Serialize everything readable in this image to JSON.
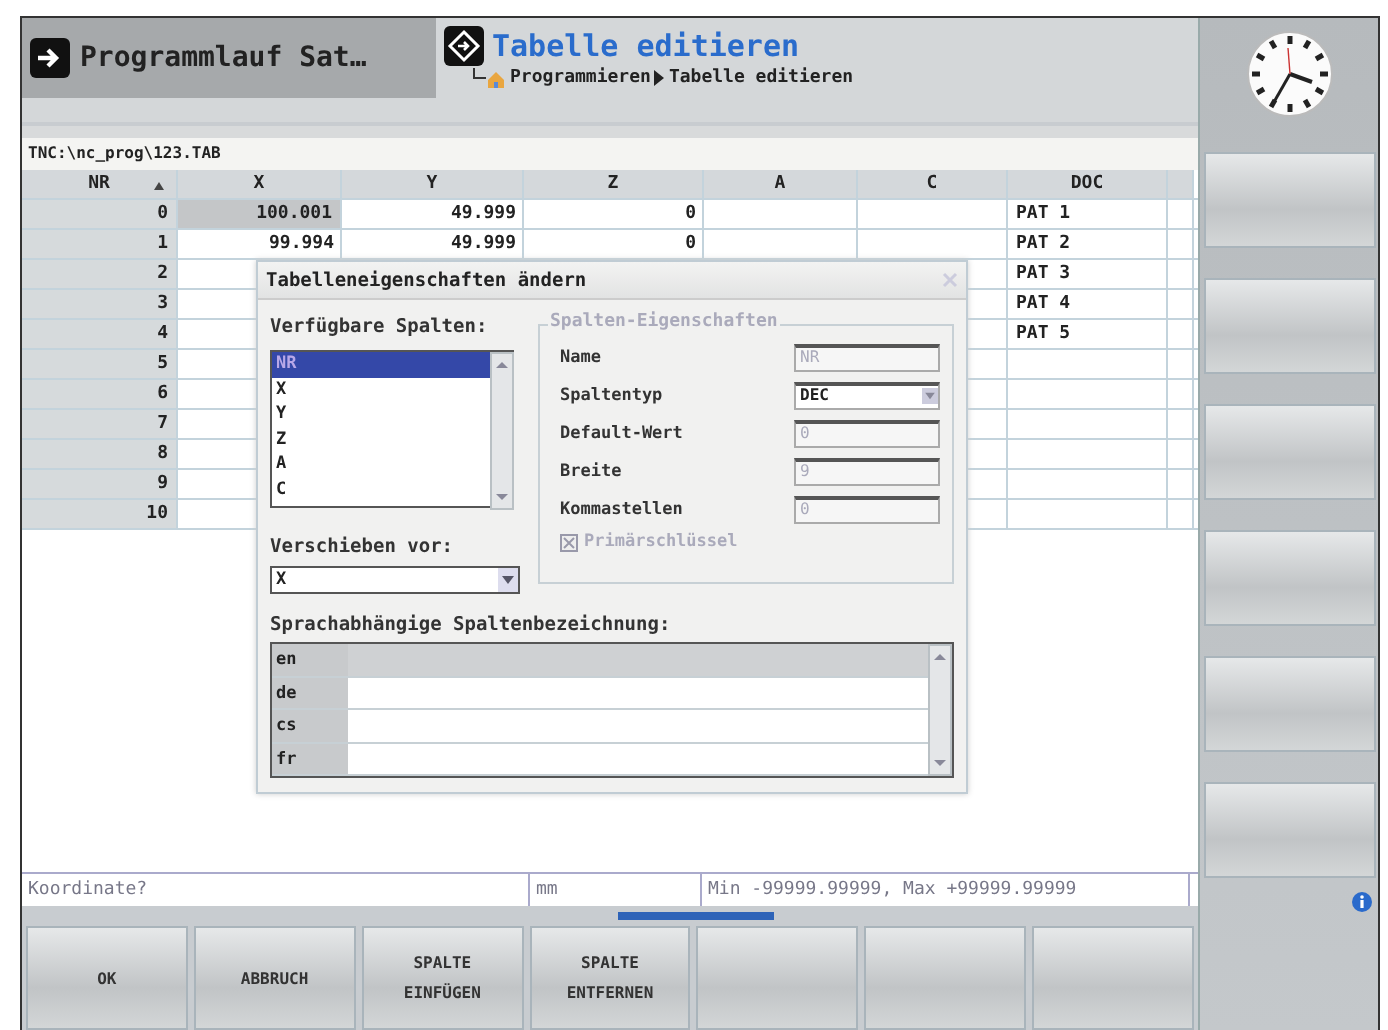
{
  "header": {
    "mode": "Programmlauf Sat…",
    "title": "Tabelle editieren",
    "breadcrumb": [
      "Programmieren",
      "Tabelle editieren"
    ]
  },
  "path": "TNC:\\nc_prog\\123.TAB",
  "table": {
    "columns": [
      {
        "label": "NR",
        "sorted": true
      },
      {
        "label": "X",
        "sorted": false
      },
      {
        "label": "Y",
        "sorted": false
      },
      {
        "label": "Z",
        "sorted": false
      },
      {
        "label": "A",
        "sorted": false
      },
      {
        "label": "C",
        "sorted": false
      },
      {
        "label": "DOC",
        "sorted": false
      }
    ],
    "rows": [
      {
        "cells": [
          {
            "text": "0",
            "selected": false
          },
          {
            "text": "100.001",
            "selected": true
          },
          {
            "text": "49.999",
            "selected": false
          },
          {
            "text": "0",
            "selected": false
          },
          null,
          null,
          {
            "text": "PAT 1",
            "selected": false
          }
        ]
      },
      {
        "cells": [
          {
            "text": "1",
            "selected": false
          },
          {
            "text": "99.994",
            "selected": false
          },
          {
            "text": "49.999",
            "selected": false
          },
          {
            "text": "0",
            "selected": false
          },
          null,
          null,
          {
            "text": "PAT 2",
            "selected": false
          }
        ]
      },
      {
        "cells": [
          {
            "text": "2",
            "selected": false
          },
          null,
          null,
          null,
          null,
          null,
          {
            "text": "PAT 3",
            "selected": false
          }
        ]
      },
      {
        "cells": [
          {
            "text": "3",
            "selected": false
          },
          null,
          null,
          null,
          null,
          null,
          {
            "text": "PAT 4",
            "selected": false
          }
        ]
      },
      {
        "cells": [
          {
            "text": "4",
            "selected": false
          },
          null,
          null,
          null,
          null,
          null,
          {
            "text": "PAT 5",
            "selected": false
          }
        ]
      },
      {
        "cells": [
          {
            "text": "5",
            "selected": false
          }
        ]
      },
      {
        "cells": [
          {
            "text": "6",
            "selected": false
          }
        ]
      },
      {
        "cells": [
          {
            "text": "7",
            "selected": false
          }
        ]
      },
      {
        "cells": [
          {
            "text": "8",
            "selected": false
          }
        ]
      },
      {
        "cells": [
          {
            "text": "9",
            "selected": false
          }
        ]
      },
      {
        "cells": [
          {
            "text": "10",
            "selected": false
          }
        ]
      }
    ]
  },
  "dialog": {
    "title": "Tabelleneigenschaften ändern",
    "columns_label": "Verfügbare Spalten:",
    "columns_list": [
      {
        "label": "NR",
        "selected": true
      },
      {
        "label": "X",
        "selected": false
      },
      {
        "label": "Y",
        "selected": false
      },
      {
        "label": "Z",
        "selected": false
      },
      {
        "label": "A",
        "selected": false
      },
      {
        "label": "C",
        "selected": false
      }
    ],
    "move_label": "Verschieben vor:",
    "move_value": "X",
    "properties_legend": "Spalten-Eigenschaften",
    "properties": [
      {
        "label": "Name",
        "value": "NR",
        "kind": "text",
        "disabled": true
      },
      {
        "label": "Spaltentyp",
        "value": "DEC",
        "kind": "dropdown",
        "disabled": false
      },
      {
        "label": "Default-Wert",
        "value": "0",
        "kind": "text",
        "disabled": true
      },
      {
        "label": "Breite",
        "value": "9",
        "kind": "text",
        "disabled": true
      },
      {
        "label": "Kommastellen",
        "value": "0",
        "kind": "text",
        "disabled": true
      }
    ],
    "primary_key": {
      "label": "Primärschlüssel",
      "checked": true,
      "disabled": true
    },
    "languages_label": "Sprachabhängige Spaltenbezeichnung:",
    "languages": [
      {
        "code": "en",
        "selected": true
      },
      {
        "code": "de",
        "selected": false
      },
      {
        "code": "cs",
        "selected": false
      },
      {
        "code": "fr",
        "selected": false
      }
    ]
  },
  "status": {
    "prompt": "Koordinate?",
    "unit": "mm",
    "range": "Min -99999.99999, Max +99999.99999"
  },
  "softkeys": [
    [
      "OK"
    ],
    [
      "ABBRUCH"
    ],
    [
      "SPALTE",
      "EINFÜGEN"
    ],
    [
      "SPALTE",
      "ENTFERNEN"
    ]
  ]
}
